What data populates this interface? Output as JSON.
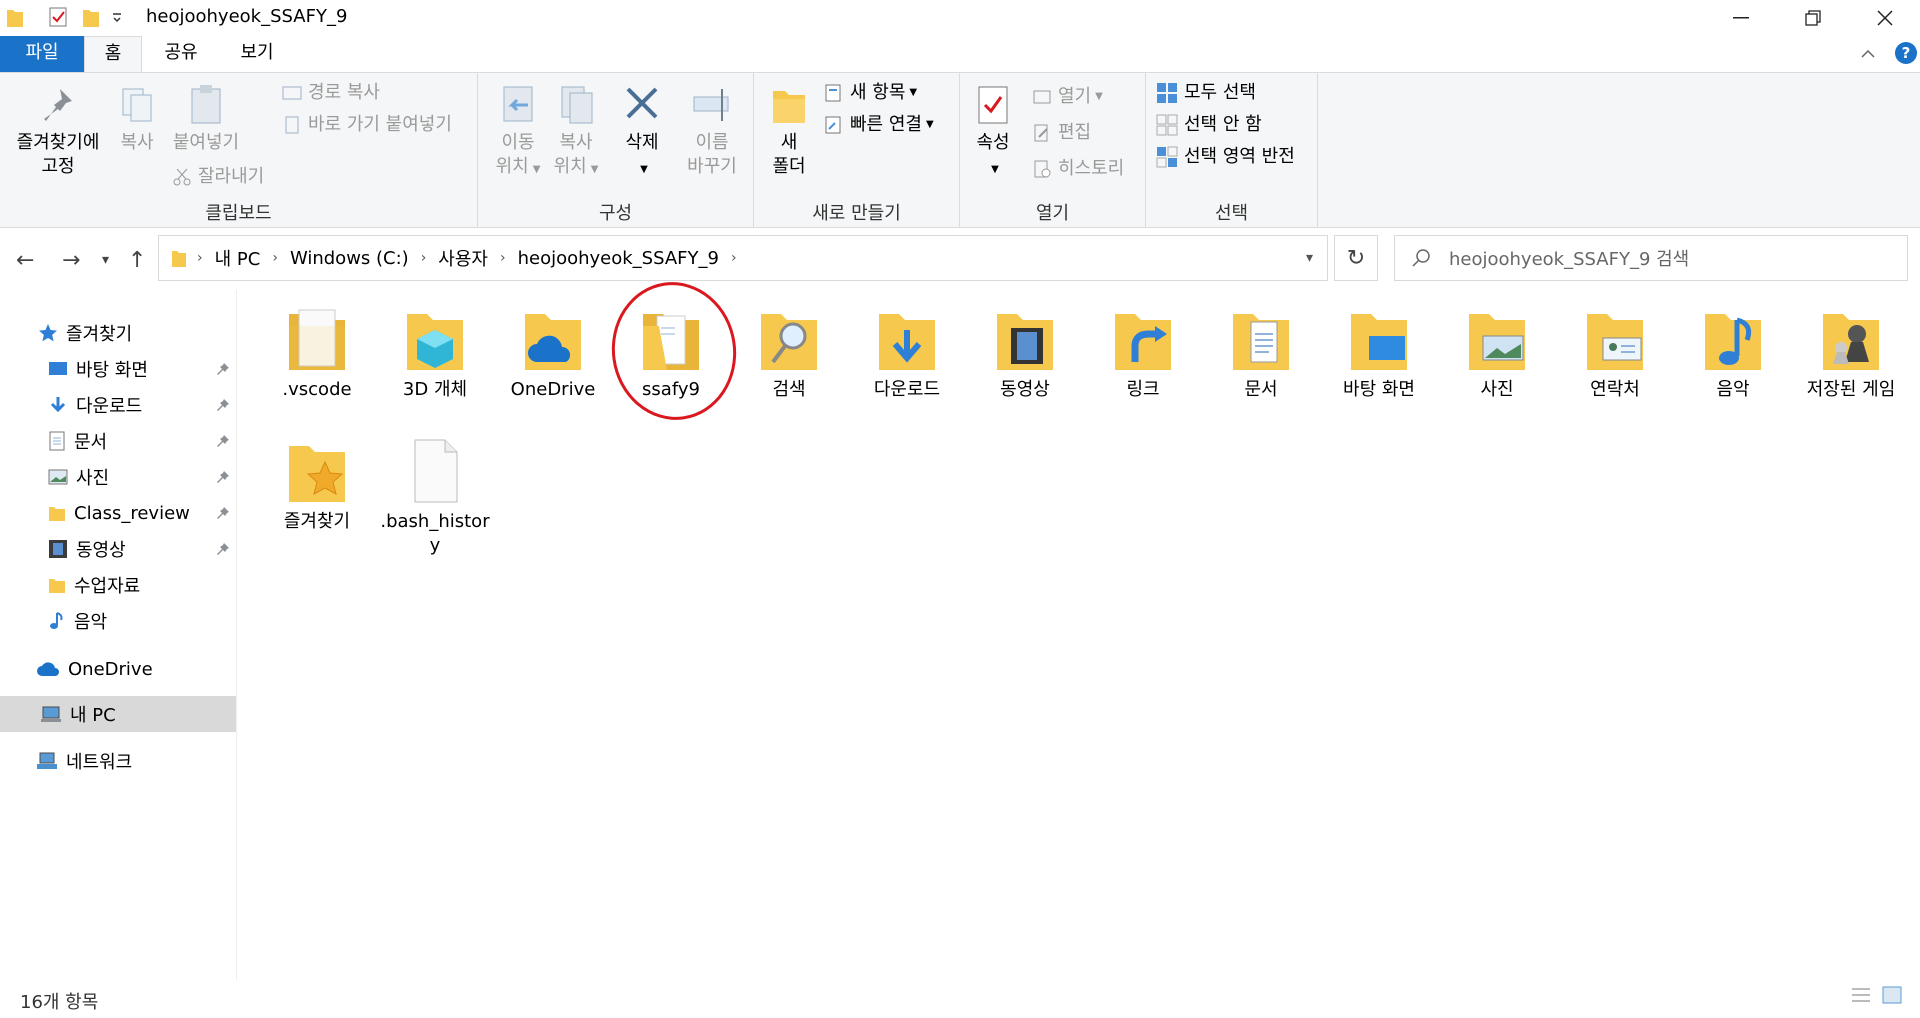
{
  "window": {
    "title": "heojoohyeok_SSAFY_9"
  },
  "tabs": {
    "file": "파일",
    "home": "홈",
    "share": "공유",
    "view": "보기"
  },
  "ribbon": {
    "clipboard": {
      "label": "클립보드",
      "pin_line1": "즐겨찾기에",
      "pin_line2": "고정",
      "copy": "복사",
      "paste": "붙여넣기",
      "copy_path": "경로 복사",
      "paste_shortcut": "바로 가기 붙여넣기",
      "cut": "잘라내기"
    },
    "organize": {
      "label": "구성",
      "move_line1": "이동",
      "move_line2": "위치",
      "copyto_line1": "복사",
      "copyto_line2": "위치",
      "delete": "삭제",
      "rename_line1": "이름",
      "rename_line2": "바꾸기"
    },
    "new": {
      "label": "새로 만들기",
      "folder_line1": "새",
      "folder_line2": "폴더",
      "new_item": "새 항목",
      "easy_access": "빠른 연결"
    },
    "open": {
      "label": "열기",
      "properties": "속성",
      "open": "열기",
      "edit": "편집",
      "history": "히스토리"
    },
    "select": {
      "label": "선택",
      "select_all": "모두 선택",
      "select_none": "선택 안 함",
      "invert": "선택 영역 반전"
    }
  },
  "address": {
    "crumbs": [
      "내 PC",
      "Windows (C:)",
      "사용자",
      "heojoohyeok_SSAFY_9"
    ],
    "search_placeholder": "heojoohyeok_SSAFY_9 검색"
  },
  "sidebar": {
    "quick_access": "즐겨찾기",
    "items": [
      "바탕 화면",
      "다운로드",
      "문서",
      "사진",
      "Class_review",
      "동영상",
      "수업자료",
      "음악"
    ],
    "onedrive": "OneDrive",
    "this_pc": "내 PC",
    "network": "네트워크"
  },
  "files": [
    {
      "name": ".vscode",
      "icon": "folder-doc-icon"
    },
    {
      "name": "3D 개체",
      "icon": "folder-3d-icon"
    },
    {
      "name": "OneDrive",
      "icon": "folder-onedrive-icon"
    },
    {
      "name": "ssafy9",
      "icon": "folder-open-icon"
    },
    {
      "name": "검색",
      "icon": "folder-search-icon"
    },
    {
      "name": "다운로드",
      "icon": "folder-download-icon"
    },
    {
      "name": "동영상",
      "icon": "folder-video-icon"
    },
    {
      "name": "링크",
      "icon": "folder-link-icon"
    },
    {
      "name": "문서",
      "icon": "folder-document-icon"
    },
    {
      "name": "바탕 화면",
      "icon": "folder-desktop-icon"
    },
    {
      "name": "사진",
      "icon": "folder-pictures-icon"
    },
    {
      "name": "연락처",
      "icon": "folder-contacts-icon"
    },
    {
      "name": "음악",
      "icon": "folder-music-icon"
    },
    {
      "name": "저장된 게임",
      "icon": "folder-games-icon"
    },
    {
      "name": "즐겨찾기",
      "icon": "folder-favorites-icon"
    },
    {
      "name": ".bash_history",
      "icon": "file-icon"
    }
  ],
  "status": {
    "count": "16개 항목"
  },
  "colors": {
    "accent": "#1a73c8",
    "folder": "#f6c94e",
    "annotation": "#d9191f"
  }
}
